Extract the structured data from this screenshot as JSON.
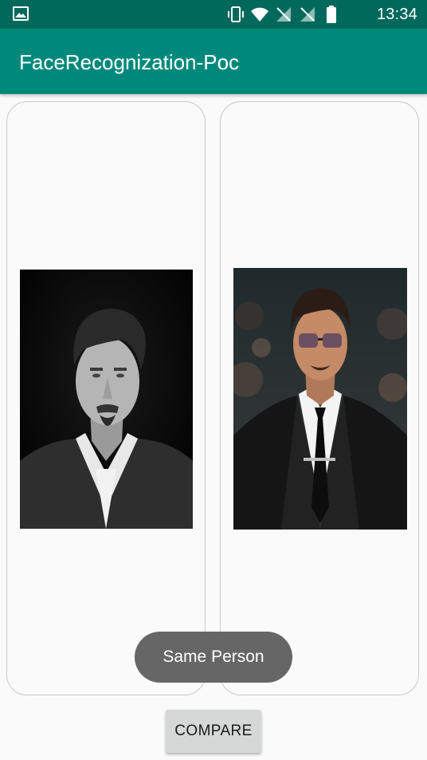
{
  "status_bar": {
    "time": "13:34",
    "icons": [
      "gallery-icon",
      "vibrate-icon",
      "wifi-icon",
      "signal-off-icon",
      "signal-off-icon",
      "battery-icon"
    ]
  },
  "app_bar": {
    "title": "FaceRecognization-Poc"
  },
  "images": {
    "left": "portrait-photo-bw",
    "right": "portrait-photo-color"
  },
  "toast": {
    "text": "Same Person"
  },
  "compare_button": {
    "label": "COMPARE"
  },
  "colors": {
    "status_bar": "#00695c",
    "app_bar": "#00897b",
    "toast": "#666666",
    "button": "#d6d7d7"
  }
}
